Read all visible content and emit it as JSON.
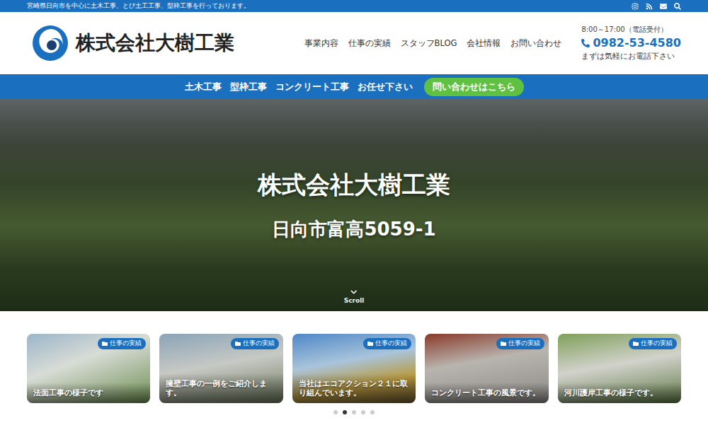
{
  "top_bar": {
    "text": "宮崎県日向市を中心に土木工事、とび土工工事、型枠工事を行っております。"
  },
  "header": {
    "logo": "株式会社大樹工業",
    "nav": [
      "事業内容",
      "仕事の実績",
      "スタッフBLOG",
      "会社情報",
      "お問い合わせ"
    ],
    "hours": "8:00～17:00（電話受付）",
    "phone": "0982-53-4580",
    "phone_note": "まずは気軽にお電話下さい"
  },
  "banner": {
    "phrases": [
      "土木工事",
      "型枠工事",
      "コンクリート工事",
      "お任せ下さい"
    ],
    "button": "問い合わせはこちら"
  },
  "hero": {
    "title": "株式会社大樹工業",
    "address": "日向市富高5059-1",
    "scroll": "Scroll"
  },
  "cards": [
    {
      "category": "仕事の実績",
      "title": "法面工事の様子です"
    },
    {
      "category": "仕事の実績",
      "title": "擁壁工事の一例をご紹介します。"
    },
    {
      "category": "仕事の実績",
      "title": "当社はエコアクション２１に取り組んでいます。"
    },
    {
      "category": "仕事の実績",
      "title": "コンクリート工事の風景です。"
    },
    {
      "category": "仕事の実績",
      "title": "河川護岸工事の様子です。"
    }
  ],
  "pager": [
    {
      "selected": false
    },
    {
      "selected": true
    },
    {
      "selected": false
    },
    {
      "selected": false
    },
    {
      "selected": false
    }
  ]
}
